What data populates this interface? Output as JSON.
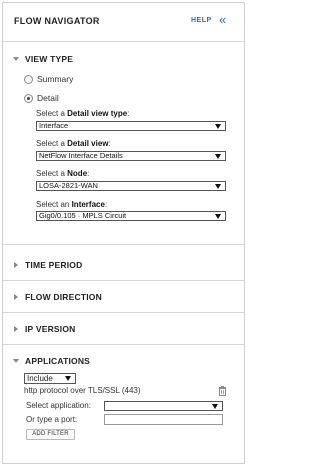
{
  "header": {
    "title": "FLOW NAVIGATOR",
    "help_label": "HELP",
    "collapse_glyph": "«"
  },
  "sections": {
    "view_type": {
      "title": "VIEW TYPE",
      "expanded": true
    },
    "time_period": {
      "title": "TIME PERIOD",
      "expanded": false
    },
    "flow_direction": {
      "title": "FLOW DIRECTION",
      "expanded": false
    },
    "ip_version": {
      "title": "IP VERSION",
      "expanded": false
    },
    "applications": {
      "title": "APPLICATIONS",
      "expanded": true
    }
  },
  "view_type": {
    "options": [
      {
        "label": "Summary",
        "checked": false
      },
      {
        "label": "Detail",
        "checked": true
      }
    ],
    "fields": {
      "detail_view_type": {
        "prefix": "Select a ",
        "bold": "Detail view type",
        "suffix": ":",
        "value": "Interface"
      },
      "detail_view": {
        "prefix": "Select a ",
        "bold": "Detail view",
        "suffix": ":",
        "value": "NetFlow Interface Details"
      },
      "node": {
        "prefix": "Select a ",
        "bold": "Node",
        "suffix": ":",
        "value": "LOSA-2821-WAN"
      },
      "interface": {
        "prefix": "Select an ",
        "bold": "Interface",
        "suffix": ":",
        "value": "Gig0/0.105 · MPLS Circuit"
      }
    }
  },
  "applications": {
    "include_value": "Include",
    "selected_app": "http protocol over TLS/SSL (443)",
    "select_app_label": "Select application:",
    "select_app_value": "",
    "port_label": "Or type a port:",
    "port_value": "",
    "add_filter_label": "ADD FILTER"
  },
  "colors": {
    "link": "#2f6fae",
    "divider": "#d6d6d6",
    "arrow": "#888888"
  }
}
